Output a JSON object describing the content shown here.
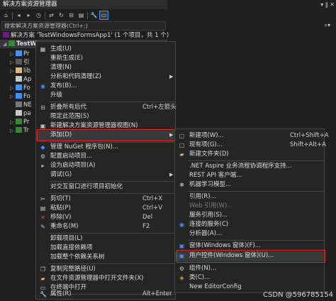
{
  "pane": {
    "title": "解决方案资源管理器",
    "title_buttons": "▾ ‖ ✕",
    "search_placeholder": "搜索解决方案资源管理器(Ctrl+;)",
    "solution_label": "解决方案 'TestWindowsFormsApp1' (1 个项目，共 1 个)",
    "project_label": "TestW",
    "tree_items": [
      "Pr",
      "引",
      "lib",
      "Ap",
      "Fo",
      "Fo",
      "NE",
      "pa",
      "Pr",
      "Tr"
    ]
  },
  "menu1": {
    "items": [
      {
        "label": "生成(U)",
        "shortcut": "",
        "icon": "build-icon"
      },
      {
        "label": "重新生成(E)",
        "shortcut": "",
        "icon": ""
      },
      {
        "label": "清理(N)",
        "shortcut": "",
        "icon": ""
      },
      {
        "label": "分析和代码清理(Z)",
        "shortcut": "",
        "icon": "",
        "submenu": true
      },
      {
        "label": "发布(B)...",
        "shortcut": "",
        "icon": "publish-icon"
      },
      {
        "label": "升级",
        "shortcut": "",
        "icon": ""
      },
      {
        "label": "折叠所有后代",
        "shortcut": "Ctrl+左箭头",
        "icon": "collapse-icon"
      },
      {
        "label": "限定此范围(S)",
        "shortcut": "",
        "icon": ""
      },
      {
        "label": "新建解决方案资源管理器视图(N)",
        "shortcut": "",
        "icon": "new-view-icon"
      },
      {
        "label": "添加(D)",
        "shortcut": "",
        "icon": "",
        "submenu": true
      },
      {
        "label": "管理 NuGet 程序包(N)...",
        "shortcut": "",
        "icon": "nuget-icon"
      },
      {
        "label": "配置启动项目...",
        "shortcut": "",
        "icon": "settings-icon"
      },
      {
        "label": "设为启动项目(A)",
        "shortcut": "",
        "icon": "startup-icon"
      },
      {
        "label": "调试(G)",
        "shortcut": "",
        "icon": "",
        "submenu": true
      },
      {
        "label": "对交互窗口进行项目初始化",
        "shortcut": "",
        "icon": ""
      },
      {
        "label": "剪切(T)",
        "shortcut": "Ctrl+X",
        "icon": "cut-icon"
      },
      {
        "label": "粘贴(P)",
        "shortcut": "Ctrl+V",
        "icon": "paste-icon"
      },
      {
        "label": "移除(V)",
        "shortcut": "Del",
        "icon": "remove-icon"
      },
      {
        "label": "重命名(M)",
        "shortcut": "F2",
        "icon": "rename-icon"
      },
      {
        "label": "卸载项目(L)",
        "shortcut": "",
        "icon": ""
      },
      {
        "label": "加载直接依赖项",
        "shortcut": "",
        "icon": ""
      },
      {
        "label": "加载整个依赖关系树",
        "shortcut": "",
        "icon": ""
      },
      {
        "label": "复制完整路径(U)",
        "shortcut": "",
        "icon": "copy-path-icon"
      },
      {
        "label": "在文件资源管理器中打开文件夹(X)",
        "shortcut": "",
        "icon": "folder-open-icon"
      },
      {
        "label": "在终端中打开",
        "shortcut": "",
        "icon": "terminal-icon"
      },
      {
        "label": "属性(R)",
        "shortcut": "Alt+Enter",
        "icon": "wrench-icon"
      }
    ]
  },
  "menu2": {
    "items": [
      {
        "label": "新建项(W)...",
        "shortcut": "Ctrl+Shift+A",
        "icon": "new-item-icon",
        "disabled": false
      },
      {
        "label": "现有项(G)...",
        "shortcut": "Shift+Alt+A",
        "icon": "existing-item-icon",
        "disabled": false
      },
      {
        "label": "新建文件夹(D)",
        "shortcut": "",
        "icon": "new-folder-icon",
        "disabled": false
      },
      {
        "label": ".NET Aspire 业务流程协调程序支持...",
        "shortcut": "",
        "icon": "",
        "disabled": false
      },
      {
        "label": "REST API 客户端...",
        "shortcut": "",
        "icon": "",
        "disabled": false
      },
      {
        "label": "机器学习模型...",
        "shortcut": "",
        "icon": "ml-icon",
        "disabled": false
      },
      {
        "label": "引用(R)...",
        "shortcut": "",
        "icon": "",
        "disabled": false
      },
      {
        "label": "Web 引用(W)...",
        "shortcut": "",
        "icon": "",
        "disabled": true
      },
      {
        "label": "服务引用(S)...",
        "shortcut": "",
        "icon": "",
        "disabled": false
      },
      {
        "label": "连接的服务(C)",
        "shortcut": "",
        "icon": "connected-service-icon",
        "disabled": false
      },
      {
        "label": "分析器(A)...",
        "shortcut": "",
        "icon": "",
        "disabled": false
      },
      {
        "label": "窗体(Windows 窗体)(F)...",
        "shortcut": "",
        "icon": "form-icon",
        "disabled": false
      },
      {
        "label": "用户控件(Windows 窗体)(U)...",
        "shortcut": "",
        "icon": "user-control-icon",
        "disabled": false
      },
      {
        "label": "组件(N)...",
        "shortcut": "",
        "icon": "component-icon",
        "disabled": false
      },
      {
        "label": "类(C)...",
        "shortcut": "",
        "icon": "class-icon",
        "disabled": false
      },
      {
        "label": "New EditorConfig",
        "shortcut": "",
        "icon": "",
        "disabled": false
      }
    ]
  },
  "watermark": "CSDN @596785154",
  "colors": {
    "accent": "#3794ff",
    "highlight_border": "#e0281e",
    "menu_bg": "#252526"
  }
}
